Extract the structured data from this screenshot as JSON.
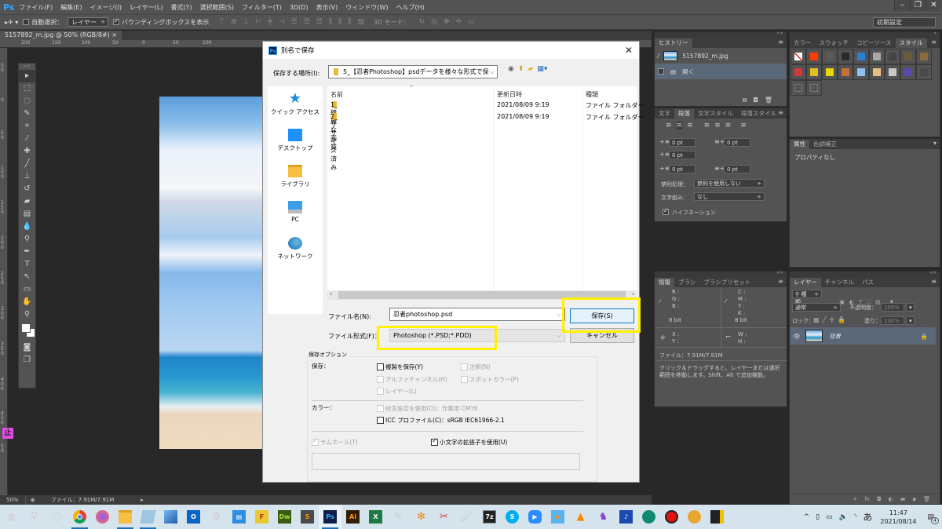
{
  "app": {
    "logo": "Ps",
    "menu": [
      "ファイル(F)",
      "編集(E)",
      "イメージ(I)",
      "レイヤー(L)",
      "書式(Y)",
      "選択範囲(S)",
      "フィルター(T)",
      "3D(D)",
      "表示(V)",
      "ウィンドウ(W)",
      "ヘルプ(H)"
    ],
    "window_controls": {
      "minimize": "–",
      "restore": "❐",
      "close": "✕"
    }
  },
  "options_bar": {
    "auto_select_label": "自動選択：",
    "auto_select_checked": false,
    "auto_select_target": "レイヤー",
    "bounding_box_label": "バウンディングボックスを表示",
    "bounding_box_checked": true,
    "mode_3d_label": "3D モード：",
    "workspace_preset": "初期設定"
  },
  "document": {
    "tab_title": "5157892_m.jpg @ 50% (RGB/8#)",
    "tab_close": "×",
    "ruler_h": [
      "200",
      "150",
      "100",
      "50",
      "0",
      "50",
      "100"
    ],
    "ruler_v": [
      "50",
      "0",
      "50",
      "100",
      "150",
      "200",
      "250",
      "300",
      "350",
      "400",
      "450",
      "50"
    ]
  },
  "statusbar": {
    "zoom": "50%",
    "file_info": "ファイル：7.91M/7.91M"
  },
  "toolbox": {
    "tools": [
      "move",
      "marquee",
      "lasso",
      "quick-select",
      "crop",
      "eyedropper",
      "healing",
      "brush",
      "stamp",
      "history-brush",
      "eraser",
      "gradient",
      "blur",
      "dodge",
      "pen",
      "type",
      "path-select",
      "shape",
      "hand",
      "zoom"
    ],
    "badge": "止"
  },
  "dialog": {
    "title": "別名で保存",
    "close": "✕",
    "location_label": "保存する場所(I):",
    "location_value": "5_【忍者Photoshop】psdデータを様々な形式で保",
    "places": [
      {
        "label": "クイック アクセス",
        "icon": "star-icon"
      },
      {
        "label": "デスクトップ",
        "icon": "desktop-icon"
      },
      {
        "label": "ライブラリ",
        "icon": "library-icon"
      },
      {
        "label": "PC",
        "icon": "pc-icon"
      },
      {
        "label": "ネットワーク",
        "icon": "network-icon"
      }
    ],
    "columns": {
      "name": "名前",
      "date": "更新日時",
      "type": "種類"
    },
    "files": [
      {
        "name": "1_綺麗な画質",
        "date": "2021/08/09 9:19",
        "type": "ファイル フォルダー"
      },
      {
        "name": "2_リサイズ済み",
        "date": "2021/08/09 9:19",
        "type": "ファイル フォルダー"
      }
    ],
    "filename_label": "ファイル名(N):",
    "filename_value": "忍者photoshop.psd",
    "filetype_label": "ファイル形式(F)：",
    "filetype_value": "Photoshop (*.PSD;*.PDD)",
    "save_button": "保存(S)",
    "cancel_button": "キャンセル",
    "options_legend": "保存オプション",
    "save_section_label": "保存：",
    "color_section_label": "カラー：",
    "options": {
      "as_copy": {
        "label": "複製を保存(Y)",
        "checked": false,
        "enabled": true
      },
      "notes": {
        "label": "注釈(N)",
        "checked": false,
        "enabled": false
      },
      "alpha": {
        "label": "アルファチャンネル(H)",
        "checked": false,
        "enabled": false
      },
      "spot": {
        "label": "スポットカラー(P)",
        "checked": false,
        "enabled": false
      },
      "layers": {
        "label": "レイヤー(L)",
        "checked": false,
        "enabled": false
      },
      "proof": {
        "label": "校正設定を使用(O)：作業用 CMYK",
        "checked": false,
        "enabled": false
      },
      "icc": {
        "label": "ICC プロファイル(C)：sRGB IEC61966-2.1",
        "checked": false,
        "enabled": true
      },
      "thumbnail": {
        "label": "サムネール(T)",
        "checked": true,
        "enabled": false
      },
      "lowercase": {
        "label": "小文字の拡張子を使用(U)",
        "checked": true,
        "enabled": true
      }
    }
  },
  "panels": {
    "history": {
      "tab": "ヒストリー",
      "snapshot": "5157892_m.jpg",
      "items": [
        "開く"
      ]
    },
    "paragraph": {
      "tabs": [
        "文字",
        "段落",
        "文字スタイル",
        "段落スタイル"
      ],
      "active_tab": "段落",
      "indent_left": "0 pt",
      "indent_right": "0 pt",
      "indent_first": "0 pt",
      "space_before": "0 pt",
      "space_after": "0 pt",
      "kinsoku_label": "禁則処理：",
      "kinsoku_value": "禁則を使用しない",
      "mojikumi_label": "文字組み：",
      "mojikumi_value": "なし",
      "hyphenation_label": "ハイフネーション",
      "hyphenation_checked": true
    },
    "styles": {
      "tabs": [
        "カラー",
        "スウォッチ",
        "コピーソース",
        "スタイル"
      ],
      "active_tab": "スタイル",
      "swatches": [
        "#ffffff",
        "#ff3b00",
        "#5a5a5a",
        "#2a2a2a",
        "#2b7fd6",
        "#a8a8a8",
        "#444444",
        "#6e5a3a",
        "#8a6d3b",
        "#d23a3a",
        "#e0c020",
        "#e8d800",
        "#c8703a",
        "#8ec0f0",
        "#e8c080",
        "#c8c8c8",
        "#5a4ab0",
        "#4a4a4a",
        "#4a4a4a",
        "#4a4a4a"
      ]
    },
    "properties": {
      "tabs": [
        "属性",
        "色調補正"
      ],
      "active_tab": "属性",
      "content": "プロパティなし"
    },
    "info": {
      "tabs": [
        "情報",
        "ブラシ",
        "ブラシプリセット"
      ],
      "active_tab": "情報",
      "rgb_labels": [
        "R :",
        "G :",
        "B :"
      ],
      "cmyk_labels": [
        "C :",
        "M :",
        "Y :",
        "K :"
      ],
      "bit_left": "8 bit",
      "bit_right": "8 bit",
      "xy_labels": [
        "X :",
        "Y :"
      ],
      "wh_labels": [
        "W :",
        "H :"
      ],
      "file": "ファイル：7.91M/7.91M",
      "hint": "クリック＆ドラッグすると、レイヤーまたは選択範囲を移動します。Shift、Alt で追加機能。"
    },
    "layers": {
      "tabs": [
        "レイヤー",
        "チャンネル",
        "パス"
      ],
      "active_tab": "レイヤー",
      "filter_kind": "種類",
      "blend_mode": "通常",
      "opacity_label": "不透明度：",
      "opacity_value": "100%",
      "lock_label": "ロック：",
      "fill_label": "塗り：",
      "fill_value": "100%",
      "layer_name": "背景"
    }
  },
  "taskbar": {
    "apps": [
      "start",
      "search",
      "cortana",
      "chrome",
      "firefox",
      "explorer",
      "notepad",
      "photos",
      "outlook",
      "settings",
      "contacts",
      "ffftp",
      "dreamweaver",
      "sublime",
      "photoshop",
      "illustrator",
      "excel",
      "editor",
      "butterfly",
      "snipping",
      "paint",
      "7zip",
      "skype",
      "zoom",
      "media",
      "vlc",
      "purple",
      "music",
      "globe",
      "recorder",
      "mascot",
      "sticky"
    ],
    "time": "11:47",
    "date": "2021/08/14",
    "ime": "あ",
    "notifications": "4"
  }
}
